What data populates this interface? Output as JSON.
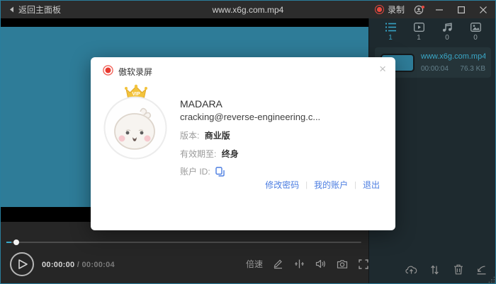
{
  "titlebar": {
    "back_label": "返回主面板",
    "title": "www.x6g.com.mp4",
    "record_label": "录制"
  },
  "sidebar": {
    "tabs": [
      {
        "icon": "list-icon",
        "count": "1",
        "active": true
      },
      {
        "icon": "video-icon",
        "count": "1",
        "active": false
      },
      {
        "icon": "music-icon",
        "count": "0",
        "active": false
      },
      {
        "icon": "image-icon",
        "count": "0",
        "active": false
      }
    ],
    "file": {
      "name": "www.x6g.com.mp4",
      "duration": "00:00:04",
      "size": "76.3 KB"
    }
  },
  "player": {
    "current_time": "00:00:00",
    "time_separator": " / ",
    "total_time": "00:00:04",
    "speed_label": "倍速"
  },
  "dialog": {
    "app_name": "傲软录屏",
    "close_glyph": "×",
    "vip_badge": "VIP",
    "account_name": "MADARA",
    "account_email": "cracking@reverse-engineering.c...",
    "version_label": "版本:",
    "version_value": "商业版",
    "expires_label": "有效期至:",
    "expires_value": "终身",
    "account_id_label": "账户 ID:",
    "link_separator": "|",
    "links": [
      {
        "label": "修改密码"
      },
      {
        "label": "我的账户"
      },
      {
        "label": "退出"
      }
    ]
  },
  "colors": {
    "accent_teal": "#36a3c5",
    "video_teal": "#2e7c98",
    "link_blue": "#4b7de1",
    "record_red": "#e8493f"
  }
}
